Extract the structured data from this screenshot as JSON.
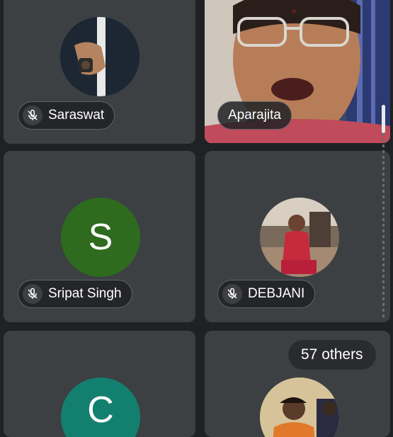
{
  "participants": [
    {
      "name": "Saraswat",
      "muted": true,
      "avatar": "photo-wrist-watch"
    },
    {
      "name": "Aparajita",
      "muted": false,
      "avatar": "video-feed-woman-glasses",
      "active_speaker": true
    },
    {
      "name": "Sripat Singh",
      "muted": true,
      "avatar_letter": "S",
      "avatar_color": "#2e6b1e"
    },
    {
      "name": "DEBJANI",
      "muted": true,
      "avatar": "photo-woman-red-dress"
    },
    {
      "name": "",
      "muted": true,
      "avatar_letter": "C",
      "avatar_color": "#13806f"
    },
    {
      "name": "",
      "muted": true,
      "avatar": "photo-man-orange-shirt"
    }
  ],
  "others": {
    "label": "57 others"
  },
  "icons": {
    "mic_off": "mic-off-icon"
  },
  "colors": {
    "background": "#202124",
    "tile": "#3c4043",
    "active_border": "#4d7ad8"
  }
}
